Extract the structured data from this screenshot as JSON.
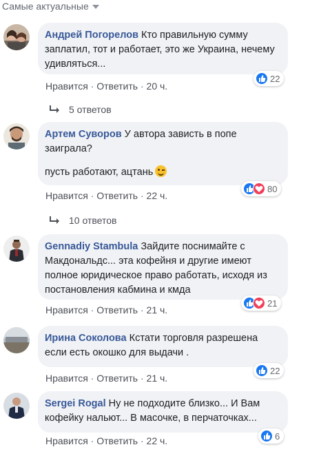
{
  "sort_label": "Самые актуальные",
  "comments": [
    {
      "author": "Андрей Погорелов",
      "text": "Кто правильную сумму заплатил, тот и работает, это же Украина, нечему удивляться...",
      "reaction_count": "22",
      "like": "Нравится",
      "reply": "Ответить",
      "time": "20 ч.",
      "replies": "5 ответов"
    },
    {
      "author": "Артем Суворов",
      "text": "У автора зависть в попе заиграла?",
      "text2": "пусть работают, ацтань",
      "reaction_count": "80",
      "like": "Нравится",
      "reply": "Ответить",
      "time": "22 ч.",
      "replies": "10 ответов"
    },
    {
      "author": "Gennadiy Stambula",
      "text": "Зайдите поснимайте с Макдональдс... эта кофейня и другие имеют полное юридическое право работать, исходя из постановления кабмина и кмда",
      "reaction_count": "21",
      "like": "Нравится",
      "reply": "Ответить",
      "time": "21 ч."
    },
    {
      "author": "Ирина Соколова",
      "text": "Кстати торговля разрешена если есть окошко для выдачи .",
      "reaction_count": "22",
      "like": "Нравится",
      "reply": "Ответить",
      "time": "21 ч."
    },
    {
      "author": "Sergei Rogal",
      "text": "Ну не подходите близко... И Вам кофейку нальют... В масочке, в перчаточках...",
      "reaction_count": "6",
      "like": "Нравится",
      "reply": "Ответить",
      "time": "22 ч."
    }
  ],
  "colors": {
    "author": "#385898",
    "bubble": "#f0f2f5",
    "like": "#1877f2",
    "love": "#f33e58"
  }
}
